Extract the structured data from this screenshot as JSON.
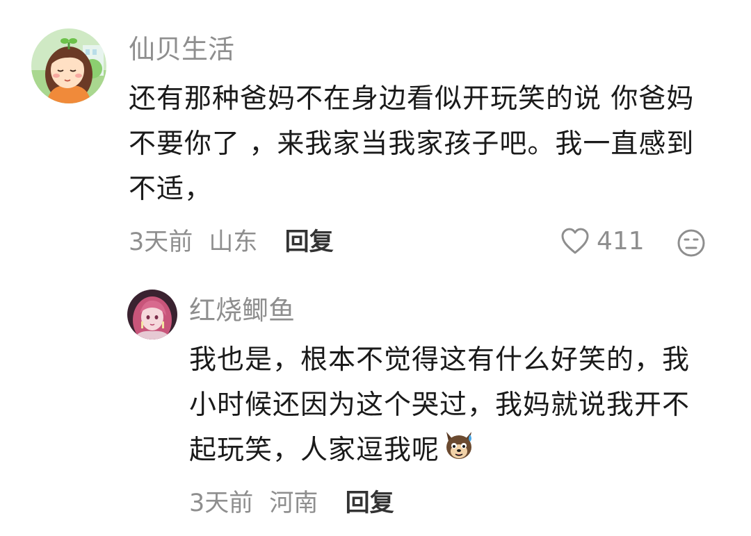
{
  "comment": {
    "username": "仙贝生活",
    "text_lines": [
      "还有那种爸妈不在身边看似开玩笑的说 你爸妈",
      "不要你了 ，来我家当我家孩子吧。我一直感到",
      "不适，"
    ],
    "time": "3天前",
    "location": "山东",
    "reply_label": "回复",
    "like_count": "411",
    "avatar_icon": "girl-avatar-icon",
    "like_icon": "heart-outline-icon",
    "dislike_icon": "unhappy-face-icon"
  },
  "reply": {
    "username": "红烧鲫鱼",
    "text_lines": [
      "我也是，根本不觉得这有什么好笑的，我",
      "小时候还因为这个哭过，我妈就说我开不",
      "起玩笑，人家逗我呢"
    ],
    "emoji_icon": "dog-sweat-emoji-icon",
    "time": "3天前",
    "location": "河南",
    "reply_label": "回复",
    "avatar_icon": "anime-girl-avatar-icon"
  },
  "colors": {
    "text": "#1a1a1a",
    "muted": "#8e8e8e",
    "reply_button": "#333333"
  }
}
